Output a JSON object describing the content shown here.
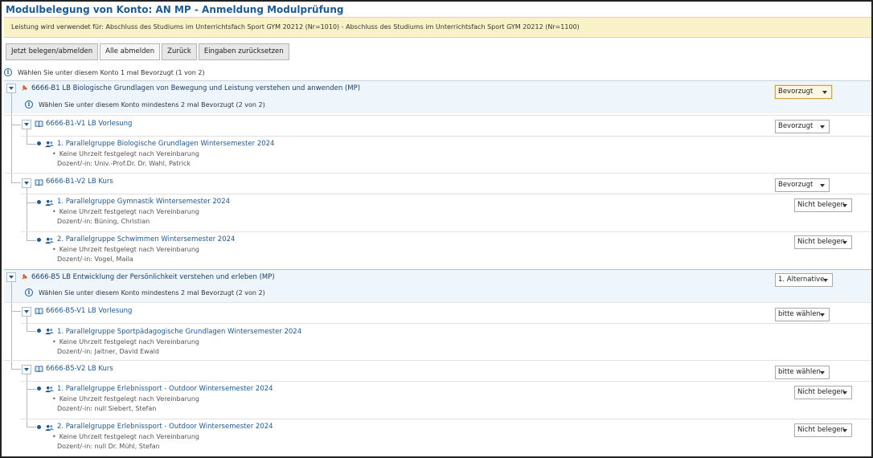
{
  "page": {
    "title": "Modulbelegung von Konto: AN MP - Anmeldung Modulprüfung",
    "notice": "Leistung wird verwendet für: Abschluss des Studiums im Unterrichtsfach Sport GYM 20212 (Nr=1010) - Abschluss des Studiums im Unterrichtsfach Sport GYM 20212 (Nr=1100)"
  },
  "toolbar": {
    "book_label": "Jetzt belegen/abmelden",
    "unsubscribe_all_label": "Alle abmelden",
    "back_label": "Zurück",
    "reset_label": "Eingaben zurücksetzen"
  },
  "account_info": "Wählen Sie unter diesem Konto 1 mal Bevorzugt (1 von 2)",
  "modules": [
    {
      "title": "6666-B1 LB Biologische Grundlagen von Bewegung und Leistung verstehen und anwenden (MP)",
      "select": "Bevorzugt",
      "info": "Wählen Sie unter diesem Konto mindestens 2 mal Bevorzugt (2 von 2)",
      "courses": [
        {
          "title": "6666-B1-V1 LB Vorlesung",
          "select": "Bevorzugt",
          "groups": [
            {
              "title": "1. Parallelgruppe Biologische Grundlagen Wintersemester 2024",
              "time": "Keine Uhrzeit festgelegt nach Vereinbarung",
              "lecturer": "Dozent/-in: Univ.-Prof.Dr. Dr. Wahl, Patrick"
            }
          ]
        },
        {
          "title": "6666-B1-V2 LB Kurs",
          "select": "Bevorzugt",
          "groups": [
            {
              "title": "1. Parallelgruppe Gymnastik Wintersemester 2024",
              "time": "Keine Uhrzeit festgelegt nach Vereinbarung",
              "lecturer": "Dozent/-in: Büning, Christian",
              "select": "Nicht belegen"
            },
            {
              "title": "2. Parallelgruppe Schwimmen Wintersemester 2024",
              "time": "Keine Uhrzeit festgelegt nach Vereinbarung",
              "lecturer": "Dozent/-in: Vogel, Maila",
              "select": "Nicht belegen"
            }
          ]
        }
      ]
    },
    {
      "title": "6666-B5 LB Entwicklung der Persönlichkeit verstehen und erleben (MP)",
      "select": "1. Alternative",
      "info": "Wählen Sie unter diesem Konto mindestens 2 mal Bevorzugt (2 von 2)",
      "courses": [
        {
          "title": "6666-B5-V1 LB Vorlesung",
          "select": "bitte wählen",
          "groups": [
            {
              "title": "1. Parallelgruppe Sportpädagogische Grundlagen Wintersemester 2024",
              "time": "Keine Uhrzeit festgelegt nach Vereinbarung",
              "lecturer": "Dozent/-in: Jaitner, David Ewald"
            }
          ]
        },
        {
          "title": "6666-B5-V2 LB Kurs",
          "select": "bitte wählen",
          "groups": [
            {
              "title": "1. Parallelgruppe Erlebnissport - Outdoor Wintersemester 2024",
              "time": "Keine Uhrzeit festgelegt nach Vereinbarung",
              "lecturer": "Dozent/-in: null Siebert, Stefan",
              "select": "Nicht belegen"
            },
            {
              "title": "2. Parallelgruppe Erlebnissport - Outdoor Wintersemester 2024",
              "time": "Keine Uhrzeit festgelegt nach Vereinbarung",
              "lecturer": "Dozent/-in: null Dr. Mühl, Stefan",
              "select": "Nicht belegen"
            }
          ]
        }
      ]
    }
  ]
}
